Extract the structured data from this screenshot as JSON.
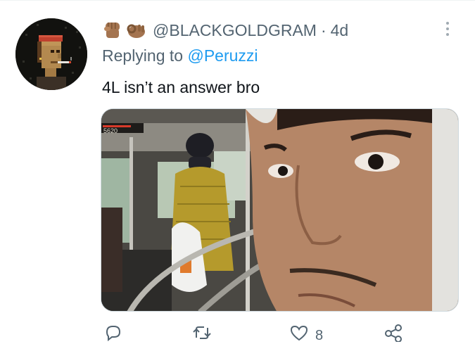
{
  "tweet": {
    "header": {
      "emoji": [
        "raised-fist-icon",
        "ok-hand-icon"
      ],
      "handle": "@BLACKGOLDGRAM",
      "separator": "·",
      "timestamp": "4d"
    },
    "reply": {
      "prefix": "Replying to",
      "mention": "@Peruzzi"
    },
    "text": "4L isn’t an answer bro",
    "media": {
      "bus_sign_text": "5620"
    },
    "actions": {
      "reply": {
        "icon": "reply-icon",
        "count": ""
      },
      "retweet": {
        "icon": "retweet-icon",
        "count": ""
      },
      "like": {
        "icon": "heart-icon",
        "count": "8"
      },
      "share": {
        "icon": "share-icon",
        "count": ""
      }
    }
  },
  "colors": {
    "secondary_text": "#536471",
    "primary_text": "#0f1419",
    "link": "#1d9bf0"
  }
}
